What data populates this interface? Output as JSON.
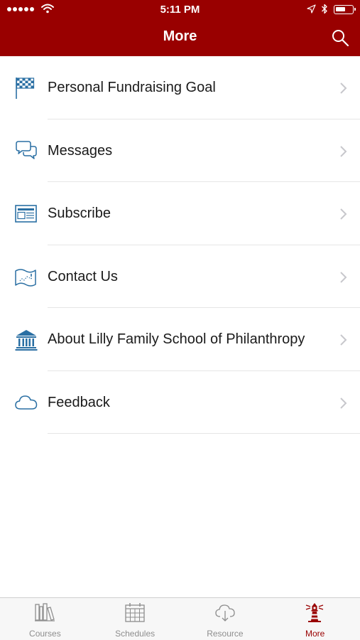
{
  "status_bar": {
    "time": "5:11 PM"
  },
  "header": {
    "title": "More"
  },
  "colors": {
    "brand": "#990000",
    "icon_blue": "#2a6fa3",
    "inactive": "#8e8e8e"
  },
  "menu": {
    "items": [
      {
        "label": "Personal Fundraising Goal",
        "icon": "checkered-flag-icon"
      },
      {
        "label": "Messages",
        "icon": "chat-bubbles-icon"
      },
      {
        "label": "Subscribe",
        "icon": "newsletter-icon"
      },
      {
        "label": "Contact Us",
        "icon": "map-icon"
      },
      {
        "label": "About Lilly Family School of Philanthropy",
        "icon": "building-columns-icon"
      },
      {
        "label": "Feedback",
        "icon": "cloud-icon"
      }
    ]
  },
  "tabbar": {
    "tabs": [
      {
        "label": "Courses",
        "icon": "books-icon",
        "active": false
      },
      {
        "label": "Schedules",
        "icon": "calendar-icon",
        "active": false
      },
      {
        "label": "Resource",
        "icon": "cloud-download-icon",
        "active": false
      },
      {
        "label": "More",
        "icon": "lighthouse-icon",
        "active": true
      }
    ]
  }
}
